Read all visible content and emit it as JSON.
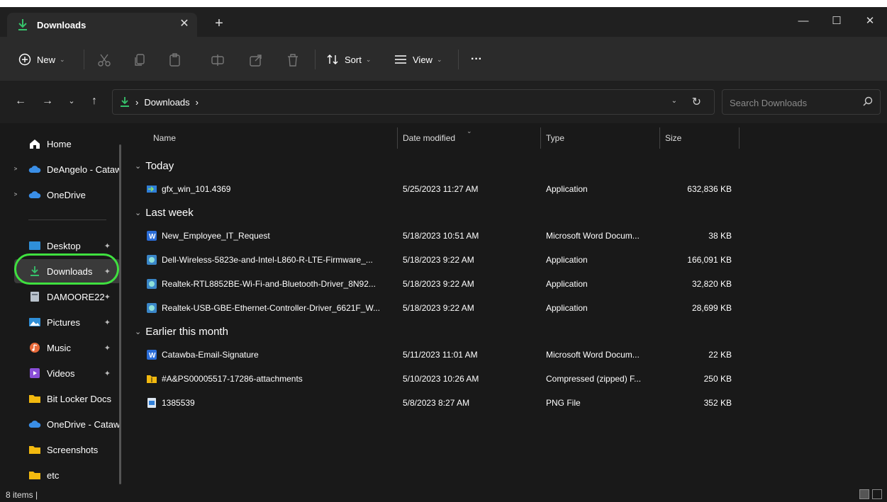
{
  "window": {
    "tab_label": "Downloads",
    "tab_close": "✕",
    "new_tab": "+",
    "minimize": "—",
    "maximize": "☐",
    "close": "✕"
  },
  "toolbar": {
    "new_label": "New",
    "sort_label": "Sort",
    "view_label": "View",
    "more_label": "···"
  },
  "address": {
    "crumbs": [
      "Downloads"
    ],
    "search_placeholder": "Search Downloads"
  },
  "sidebar": {
    "items": [
      {
        "label": "Home",
        "icon": "home-icon"
      },
      {
        "label": "DeAngelo - Catawba",
        "icon": "cloud-icon",
        "expand": ">"
      },
      {
        "label": "OneDrive",
        "icon": "cloud-icon",
        "expand": ">"
      },
      {
        "label": "Desktop",
        "icon": "desktop-icon",
        "pin": "📌"
      },
      {
        "label": "Downloads",
        "icon": "download-icon",
        "pin": "📌"
      },
      {
        "label": "DAMOORE22",
        "icon": "drive-icon",
        "pin": "📌"
      },
      {
        "label": "Pictures",
        "icon": "pictures-icon",
        "pin": "📌"
      },
      {
        "label": "Music",
        "icon": "music-icon",
        "pin": "📌"
      },
      {
        "label": "Videos",
        "icon": "videos-icon",
        "pin": "📌"
      },
      {
        "label": "Bit Locker Docs",
        "icon": "folder-icon"
      },
      {
        "label": "OneDrive - Catawba",
        "icon": "cloud-icon"
      },
      {
        "label": "Screenshots",
        "icon": "folder-icon"
      },
      {
        "label": "etc",
        "icon": "folder-icon"
      }
    ]
  },
  "columns": {
    "name": "Name",
    "date": "Date modified",
    "type": "Type",
    "size": "Size"
  },
  "groups": [
    {
      "label": "Today",
      "files": [
        {
          "name": "gfx_win_101.4369",
          "date": "5/25/2023 11:27 AM",
          "type": "Application",
          "size": "632,836 KB",
          "icon": "installer-icon"
        }
      ]
    },
    {
      "label": "Last week",
      "files": [
        {
          "name": "New_Employee_IT_Request",
          "date": "5/18/2023 10:51 AM",
          "type": "Microsoft Word Docum...",
          "size": "38 KB",
          "icon": "word-doc-icon"
        },
        {
          "name": "Dell-Wireless-5823e-and-Intel-L860-R-LTE-Firmware_...",
          "date": "5/18/2023 9:22 AM",
          "type": "Application",
          "size": "166,091 KB",
          "icon": "application-icon"
        },
        {
          "name": "Realtek-RTL8852BE-Wi-Fi-and-Bluetooth-Driver_8N92...",
          "date": "5/18/2023 9:22 AM",
          "type": "Application",
          "size": "32,820 KB",
          "icon": "application-icon"
        },
        {
          "name": "Realtek-USB-GBE-Ethernet-Controller-Driver_6621F_W...",
          "date": "5/18/2023 9:22 AM",
          "type": "Application",
          "size": "28,699 KB",
          "icon": "application-icon"
        }
      ]
    },
    {
      "label": "Earlier this month",
      "files": [
        {
          "name": "Catawba-Email-Signature",
          "date": "5/11/2023 11:01 AM",
          "type": "Microsoft Word Docum...",
          "size": "22 KB",
          "icon": "word-doc-icon"
        },
        {
          "name": "#A&PS00005517-17286-attachments",
          "date": "5/10/2023 10:26 AM",
          "type": "Compressed (zipped) F...",
          "size": "250 KB",
          "icon": "zip-folder-icon"
        },
        {
          "name": "1385539",
          "date": "5/8/2023 8:27 AM",
          "type": "PNG File",
          "size": "352 KB",
          "icon": "image-file-icon"
        }
      ]
    }
  ],
  "status": {
    "item_count": "8 items  |"
  },
  "colors": {
    "accent_green": "#3fe03f",
    "download_green": "#36c26b",
    "folder_yellow": "#f2b90f",
    "onedrive_blue": "#3a8ee6"
  }
}
